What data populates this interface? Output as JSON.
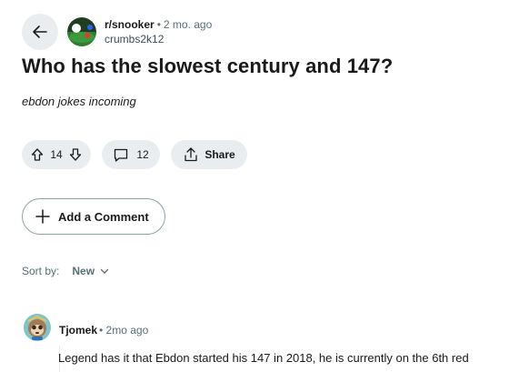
{
  "post": {
    "subreddit": "r/snooker",
    "separator": "•",
    "age": "2 mo. ago",
    "author": "crumbs2k12",
    "title": "Who has the slowest century and 147?",
    "body": "ebdon jokes incoming"
  },
  "actions": {
    "vote_count": "14",
    "comment_count": "12",
    "share_label": "Share"
  },
  "add_comment_label": "Add a Comment",
  "sort": {
    "label": "Sort by:",
    "value": "New"
  },
  "comments": [
    {
      "author": "Tjomek",
      "separator": "•",
      "age": "2mo ago",
      "text": "Legend has it that Ebdon started his 147 in 2018, he is currently on the 6th red"
    }
  ],
  "icons": {
    "back": "arrow-left-icon",
    "upvote": "arrow-up-icon",
    "downvote": "arrow-down-icon",
    "comment": "speech-bubble-icon",
    "share": "share-icon",
    "add": "plus-icon",
    "sort": "chevron-down-icon"
  },
  "colors": {
    "pill_bg": "#eaedef",
    "muted": "#576f76",
    "text": "#1a1a1b"
  }
}
